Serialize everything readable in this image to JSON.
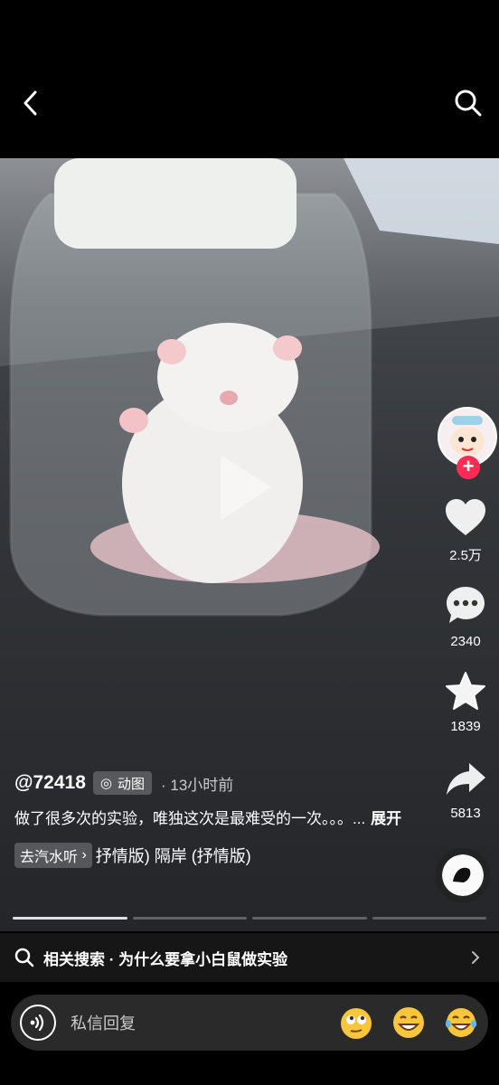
{
  "post": {
    "author": "@72418",
    "tag_label": "动图",
    "time": "13小时前",
    "description": "做了很多次的实验，唯独这次是最难受的一次。。。...",
    "more_label": "展开",
    "listen_label": "去汽水听",
    "music_text": "抒情版)  隔岸 (抒情版)"
  },
  "actions": {
    "likes": "2.5万",
    "comments": "2340",
    "favorites": "1839",
    "shares": "5813"
  },
  "playback": {
    "current_segment": 1,
    "segment_count": 4
  },
  "related": {
    "text": "相关搜索 · 为什么要拿小白鼠做实验"
  },
  "reply": {
    "placeholder": "私信回复"
  },
  "icons": [
    "back-icon",
    "search-icon",
    "play-icon",
    "heart-icon",
    "comment-icon",
    "star-icon",
    "share-icon",
    "voice-icon",
    "chevron-right-icon"
  ],
  "colors": {
    "accent": "#fe2c55",
    "background": "#000000"
  }
}
